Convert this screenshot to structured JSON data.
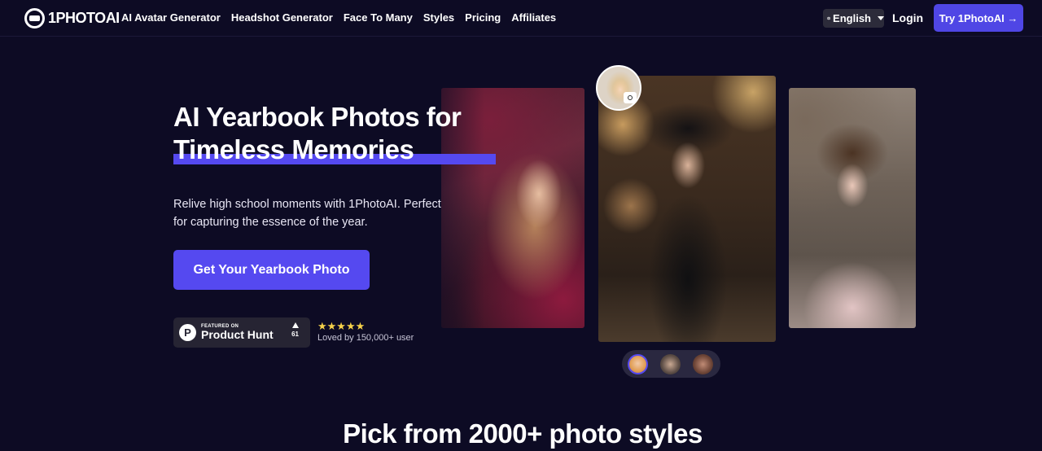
{
  "nav": {
    "brand": "1PHOTOAI",
    "links": [
      {
        "label": "AI Avatar Generator"
      },
      {
        "label": "Headshot Generator"
      },
      {
        "label": "Face To Many"
      },
      {
        "label": "Styles"
      },
      {
        "label": "Pricing"
      },
      {
        "label": "Affiliates"
      }
    ],
    "language": "English",
    "login": "Login",
    "cta": "Try 1PhotoAI →"
  },
  "hero": {
    "title_line1": "AI Yearbook Photos for",
    "title_line2": "Timeless Memories",
    "subtitle": "Relive high school moments with 1PhotoAI. Perfect for capturing the essence of the year.",
    "cta": "Get Your Yearbook Photo",
    "product_hunt": {
      "featured": "FEATURED ON",
      "name": "Product Hunt",
      "votes": "61"
    },
    "stars": "★★★★★",
    "loved": "Loved by 150,000+ user"
  },
  "icons": {
    "logo": "camera-aperture-logo",
    "language": "globe-icon",
    "dropdown": "caret-down-icon",
    "camera": "camera-icon",
    "product_hunt": "product-hunt-icon",
    "upvote": "triangle-up-icon"
  },
  "colors": {
    "background": "#0d0b24",
    "accent": "#5549f0",
    "nav_button": "#4f46e5",
    "stars": "#f6d24a"
  },
  "section": {
    "title": "Pick from 2000+ photo styles"
  }
}
